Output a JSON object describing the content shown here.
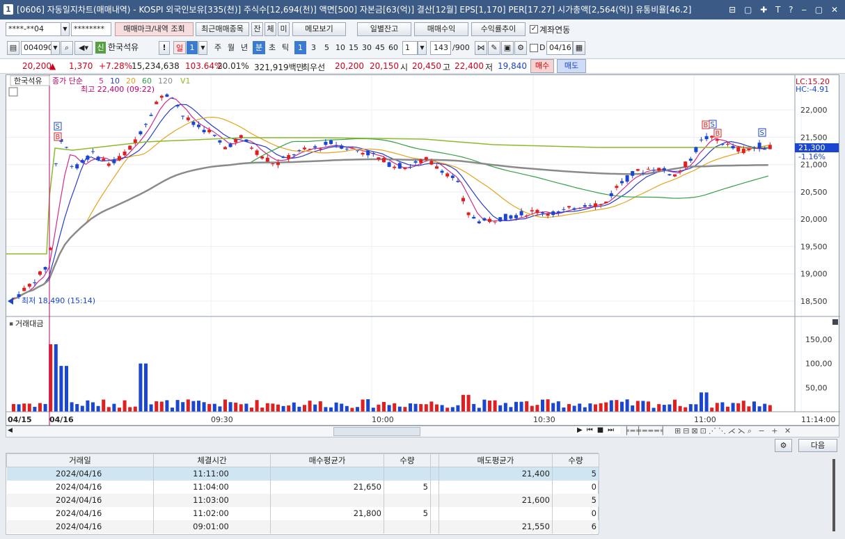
{
  "title": {
    "num": "1",
    "text": "[0606] 자동일지차트(매매내역) - KOSPI 외국인보유[335(천)] 주식수[12,694(천)] 액면[500] 자본금[63(억)] 결산[12월] EPS[1,170] PER[17.27] 시가총액[2,564(억)] 유통비율[46.2]",
    "controls": "⊟ ▢ ✚ T ? ‒ ▢ ✕"
  },
  "toolbar1": {
    "account": "****-**04",
    "password": "********",
    "mark_btn": "매매마크/내역 조회",
    "recent_btn": "최근매매종목",
    "tabs": [
      "잔",
      "체",
      "미"
    ],
    "memo_btn": "메모보기",
    "daily_btn": "일별잔고",
    "profit_btn": "매매수익",
    "trend_btn": "수익률추이",
    "link_label": "계좌연동"
  },
  "toolbar2": {
    "code": "004090",
    "stock_badge": "신",
    "stock_name": "한국석유",
    "period_buttons": [
      "일",
      "주",
      "월",
      "년",
      "분",
      "초",
      "틱"
    ],
    "minute_sel": "1",
    "day_sel": "1",
    "intervals": [
      "1",
      "3",
      "5",
      "10",
      "15",
      "30",
      "45",
      "60"
    ],
    "multi": "1",
    "count": "143",
    "count_max": "/900",
    "date_label": "D",
    "date": "04/16"
  },
  "quote": {
    "price": "20,200",
    "arrow": "▲",
    "change": "1,370",
    "rate": "+7.28%",
    "volume": "15,234,638",
    "vol_rate": "103.64%",
    "turnover": "20.01%",
    "amount": "321,919백만",
    "best_label": "최우선",
    "best_sell": "20,200",
    "best_buy": "20,150",
    "open_label": "시",
    "open": "20,450",
    "high_label": "고",
    "high": "22,400",
    "low_label": "저",
    "low": "19,840",
    "buy_btn": "매수",
    "sell_btn": "매도"
  },
  "chart": {
    "stock_label": "한국석유",
    "legend": {
      "prefix": "종가 단순",
      "ma": [
        "5",
        "10",
        "20",
        "60",
        "120"
      ],
      "ma_colors": [
        "#d02a8a",
        "#2a3cc8",
        "#e7a21b",
        "#33a048",
        "#8a8a8a"
      ],
      "v1": "V1"
    },
    "high_note": "최고 22,400 (09:22)",
    "low_note": "최저 18,490 (15:14)",
    "lc": "LC:15.20",
    "hc": "HC:-4.91",
    "last_price": "21,300",
    "last_change": "-1.16%",
    "volume_label": "거래대금",
    "dates": {
      "left": "04/15",
      "day": "04/16"
    },
    "times": [
      "09:30",
      "10:00",
      "10:30",
      "11:00",
      "11:14:00"
    ]
  },
  "chart_data": {
    "type": "candlestick",
    "price_axis": [
      "22,000",
      "21,500",
      "21,000",
      "20,500",
      "20,000",
      "19,500",
      "19,000",
      "18,500"
    ],
    "price_range": [
      18350,
      22600
    ],
    "volume_axis": [
      "150,00",
      "100,00",
      "50,00"
    ],
    "volume_range": [
      0,
      180
    ]
  },
  "grid": {
    "headers": [
      "거래일",
      "체결시간",
      "매수평균가",
      "수량",
      "",
      "매도평균가",
      "수량"
    ],
    "rows": [
      [
        "2024/04/16",
        "11:11:00",
        "",
        "",
        "",
        "21,400",
        "5"
      ],
      [
        "2024/04/16",
        "11:04:00",
        "21,650",
        "5",
        "",
        "",
        "0"
      ],
      [
        "2024/04/16",
        "11:03:00",
        "",
        "",
        "",
        "21,600",
        "5"
      ],
      [
        "2024/04/16",
        "11:02:00",
        "21,800",
        "5",
        "",
        "",
        "0"
      ],
      [
        "2024/04/16",
        "09:01:00",
        "",
        "",
        "",
        "21,550",
        "6"
      ]
    ],
    "next_btn": "다음"
  },
  "colors": {
    "up": "#e02020",
    "down": "#1a46d0",
    "accent": "#3b5a86"
  }
}
